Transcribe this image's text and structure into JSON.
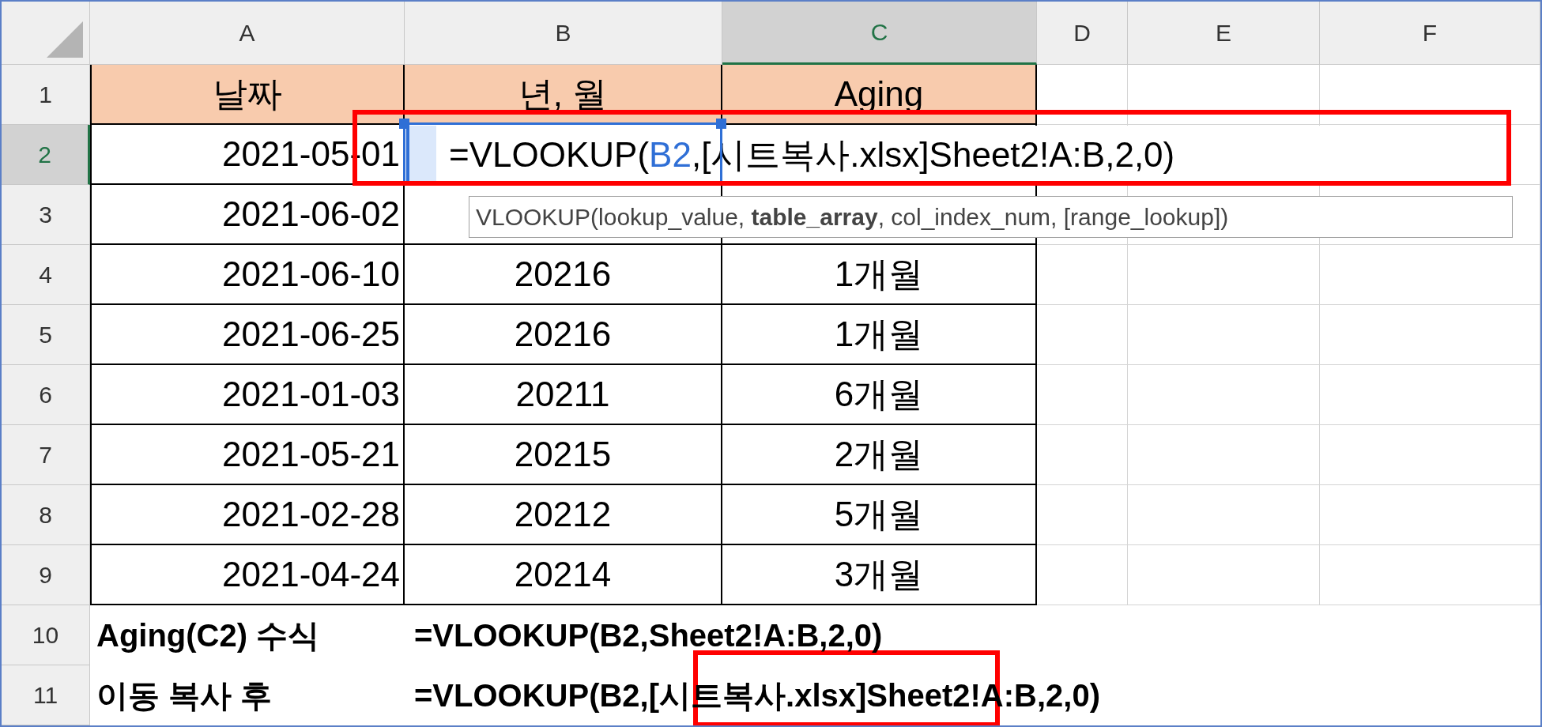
{
  "column_headers": [
    {
      "label": "A",
      "selected": false
    },
    {
      "label": "B",
      "selected": false
    },
    {
      "label": "C",
      "selected": true
    },
    {
      "label": "D",
      "selected": false
    },
    {
      "label": "E",
      "selected": false
    },
    {
      "label": "F",
      "selected": false
    }
  ],
  "row_headers": [
    {
      "label": "1",
      "selected": false
    },
    {
      "label": "2",
      "selected": true
    },
    {
      "label": "3",
      "selected": false
    },
    {
      "label": "4",
      "selected": false
    },
    {
      "label": "5",
      "selected": false
    },
    {
      "label": "6",
      "selected": false
    },
    {
      "label": "7",
      "selected": false
    },
    {
      "label": "8",
      "selected": false
    },
    {
      "label": "9",
      "selected": false
    },
    {
      "label": "10",
      "selected": false
    },
    {
      "label": "11",
      "selected": false
    }
  ],
  "table": {
    "header": [
      "날짜",
      "년, 월",
      "Aging"
    ],
    "rows": [
      [
        "2021-05-01"
      ],
      [
        "2021-06-02"
      ],
      [
        "2021-06-10",
        "20216",
        "1개월"
      ],
      [
        "2021-06-25",
        "20216",
        "1개월"
      ],
      [
        "2021-01-03",
        "20211",
        "6개월"
      ],
      [
        "2021-05-21",
        "20215",
        "2개월"
      ],
      [
        "2021-02-28",
        "20212",
        "5개월"
      ],
      [
        "2021-04-24",
        "20214",
        "3개월"
      ]
    ]
  },
  "edit_cell": {
    "before": "=VLOOKUP(",
    "ref": "B2",
    "after": ",[시트복사.xlsx]Sheet2!A:B,2,0)"
  },
  "tooltip": "VLOOKUP(lookup_value, **table_array**, col_index_num, [range_lookup])",
  "notes": [
    {
      "label": "Aging(C2) 수식",
      "formula": "=VLOOKUP(B2,Sheet2!A:B,2,0)"
    },
    {
      "label": "이동 복사 후",
      "formula": "=VLOOKUP(B2,[시트복사.xlsx]Sheet2!A:B,2,0)"
    }
  ]
}
